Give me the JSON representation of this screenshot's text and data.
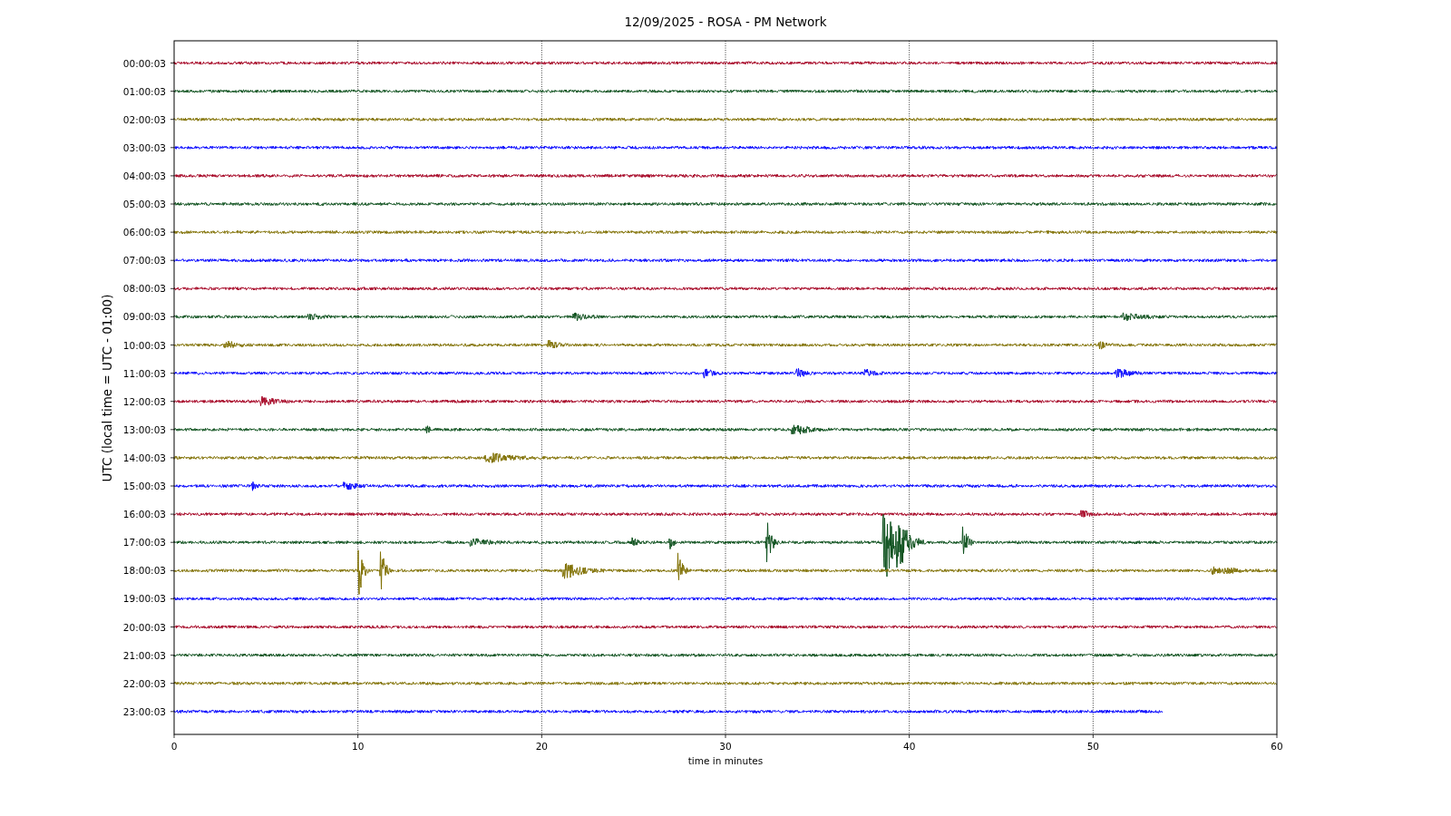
{
  "title": "12/09/2025 - ROSA - PM Network",
  "ylabel": "UTC (local time = UTC - 01:00)",
  "xlabel": "time in minutes",
  "xticks": [
    "0",
    "10",
    "20",
    "30",
    "40",
    "50",
    "60"
  ],
  "traces": [
    {
      "label": "00:00:03",
      "color": "#a50021",
      "complete": true
    },
    {
      "label": "01:00:03",
      "color": "#0b4f1b",
      "complete": true
    },
    {
      "label": "02:00:03",
      "color": "#7f6f00",
      "complete": true
    },
    {
      "label": "03:00:03",
      "color": "#0000ff",
      "complete": true
    },
    {
      "label": "04:00:03",
      "color": "#a50021",
      "complete": true
    },
    {
      "label": "05:00:03",
      "color": "#0b4f1b",
      "complete": true
    },
    {
      "label": "06:00:03",
      "color": "#7f6f00",
      "complete": true
    },
    {
      "label": "07:00:03",
      "color": "#0000ff",
      "complete": true
    },
    {
      "label": "08:00:03",
      "color": "#a50021",
      "complete": true
    },
    {
      "label": "09:00:03",
      "color": "#0b4f1b",
      "complete": true
    },
    {
      "label": "10:00:03",
      "color": "#7f6f00",
      "complete": true
    },
    {
      "label": "11:00:03",
      "color": "#0000ff",
      "complete": true
    },
    {
      "label": "12:00:03",
      "color": "#a50021",
      "complete": true
    },
    {
      "label": "13:00:03",
      "color": "#0b4f1b",
      "complete": true
    },
    {
      "label": "14:00:03",
      "color": "#7f6f00",
      "complete": true
    },
    {
      "label": "15:00:03",
      "color": "#0000ff",
      "complete": true
    },
    {
      "label": "16:00:03",
      "color": "#a50021",
      "complete": true
    },
    {
      "label": "17:00:03",
      "color": "#0b4f1b",
      "complete": true
    },
    {
      "label": "18:00:03",
      "color": "#7f6f00",
      "complete": true
    },
    {
      "label": "19:00:03",
      "color": "#0000ff",
      "complete": true
    },
    {
      "label": "20:00:03",
      "color": "#a50021",
      "complete": true
    },
    {
      "label": "21:00:03",
      "color": "#0b4f1b",
      "complete": true
    },
    {
      "label": "22:00:03",
      "color": "#7f6f00",
      "complete": true
    },
    {
      "label": "23:00:03",
      "color": "#0000ff",
      "complete": false
    }
  ]
}
